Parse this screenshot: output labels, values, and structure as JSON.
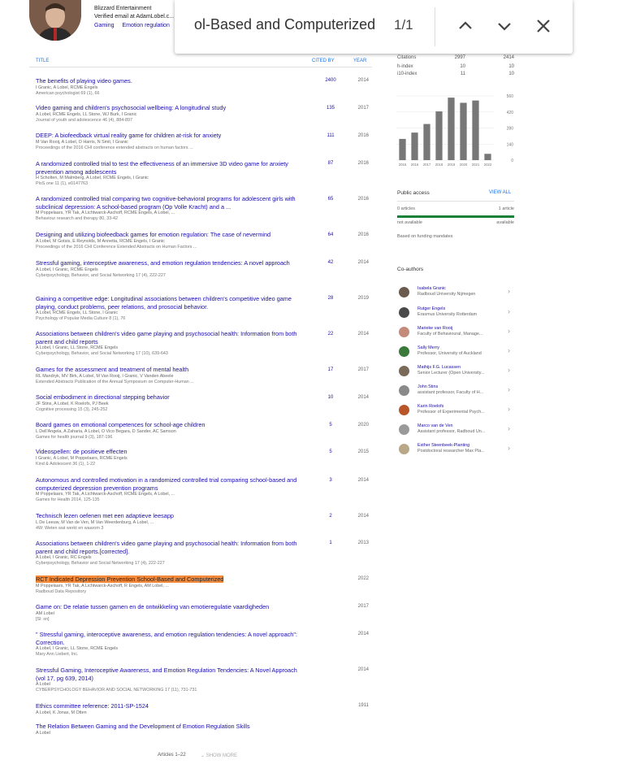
{
  "profile": {
    "affiliation": "Blizzard Entertainment",
    "email": "Verified email at AdamLobel.c...",
    "interests": [
      "Gaming",
      "Emotion regulation"
    ]
  },
  "find_bar": {
    "query": "ol-Based and Computerized",
    "count": "1/1",
    "icons": {
      "up": "chevron-up-icon",
      "down": "chevron-down-icon",
      "close": "close-icon"
    }
  },
  "table_header": {
    "title": "TITLE",
    "cited_by": "CITED BY",
    "year": "YEAR"
  },
  "publications": [
    {
      "title": "The benefits of playing video games.",
      "authors": "I Granic, A Lobel, RCME Engels",
      "venue": "American psychologist 69 (1), 66",
      "cited": "2400",
      "year": "2014"
    },
    {
      "title": "Video gaming and children's psychosocial wellbeing: A longitudinal study",
      "authors": "A Lobel, RCME Engels, LL Stone, WJ Burk, I Granic",
      "venue": "Journal of youth and adolescence 46 (4), 884-897",
      "cited": "135",
      "year": "2017"
    },
    {
      "title": "DEEP: A biofeedback virtual reality game for children at-risk for anxiety",
      "authors": "M Van Rooij, A Lobel, O Harris, N Smit, I Granic",
      "venue": "Proceedings of the 2016 CHI conference extended abstracts on human factors ...",
      "cited": "111",
      "year": "2016"
    },
    {
      "title": "A randomized controlled trial to test the effectiveness of an immersive 3D video game for anxiety prevention among adolescents",
      "authors": "H Scholten, M Malmberg, A Lobel, RCME Engels, I Granic",
      "venue": "PloS one 11 (1), e0147763",
      "cited": "87",
      "year": "2016"
    },
    {
      "title": "A randomized controlled trial comparing two cognitive-behavioral programs for adolescent girls with subclinical depression: A school-based program (Op Volle Kracht) and a ...",
      "authors": "M Poppelaars, YR Tak, A Lichtwarck-Aschoff, RCME Engels, A Lobel, ...",
      "venue": "Behaviour research and therapy 80, 33-42",
      "cited": "65",
      "year": "2016"
    },
    {
      "title": "Designing and utilizing biofeedback games for emotion regulation: The case of nevermind",
      "authors": "A Lobel, M Gotsis, E Reynolds, M Annetta, RCME Engels, I Granic",
      "venue": "Proceedings of the 2016 CHI Conference Extended Abstracts on Human Factors ...",
      "cited": "64",
      "year": "2016"
    },
    {
      "title": "Stressful gaming, interoceptive awareness, and emotion regulation tendencies: A novel approach",
      "authors": "A Lobel, I Granic, RCME Engels",
      "venue": "Cyberpsychology, Behavior, and Social Networking 17 (4), 222-227",
      "cited": "42",
      "year": "2014"
    },
    {
      "title": "Gaining a competitive edge: Longitudinal associations between children's competitive video game playing, conduct problems, peer relations, and prosocial behavior.",
      "authors": "A Lobel, RCME Engels, LL Stone, I Granic",
      "venue": "Psychology of Popular Media Culture 8 (1), 76",
      "cited": "28",
      "year": "2019"
    },
    {
      "title": "Associations between children's video game playing and psychosocial health: Information from both parent and child reports",
      "authors": "A Lobel, I Granic, LL Stone, RCME Engels",
      "venue": "Cyberpsychology, Behavior, and Social Networking 17 (10), 639-643",
      "cited": "22",
      "year": "2014"
    },
    {
      "title": "Games for the assessment and treatment of mental health",
      "authors": "RL Mandryk, MV Birk, A Lobel, M Van Rooij, I Granic, V Vanden Abeele",
      "venue": "Extended Abstracts Publication of the Annual Symposium on Computer-Human ...",
      "cited": "17",
      "year": "2017"
    },
    {
      "title": "Social embodiment in directional stepping behavior",
      "authors": "JF Stins, A Lobel, K Roelofs, PJ Beek",
      "venue": "Cognitive processing 15 (3), 245-252",
      "cited": "10",
      "year": "2014"
    },
    {
      "title": "Board games on emotional competences for school-age children",
      "authors": "L Dell'Angela, A Zaharia, A Lobel, O Vico Begara, D Sander, AC Samson",
      "venue": "Games for health journal 9 (3), 187-196",
      "cited": "5",
      "year": "2020"
    },
    {
      "title": "Videospellen: de positieve effecten",
      "authors": "I Granic, A Lobel, M Poppelaars, RCME Engels",
      "venue": "Kind & Adolescent 36 (1), 1-22",
      "cited": "5",
      "year": "2015"
    },
    {
      "title": "Autonomous and controlled motivation in a randomized controlled trial comparing school-based and computerized depression prevention programs",
      "authors": "M Poppelaars, YR Tak, A Lichtwarck-Aschoff, RCME Engels, A Lobel, ...",
      "venue": "Games for Health 2014, 125-135",
      "cited": "3",
      "year": "2014"
    },
    {
      "title": "Technisch lezen oefenen met een adaptieve leesapp",
      "authors": "L De Leeuw, M Van de Ven, M Van Weerdenburg, A Lobel, ...",
      "venue": "4W: Weten wat werkt en waarom 3",
      "cited": "2",
      "year": "2014"
    },
    {
      "title": "Associations between children's video game playing and psychosocial health: Information from both parent and child reports.[corrected].",
      "authors": "A Lobel, I Granic, RC Engels",
      "venue": "Cyberpsychology, Behavior and Social Networking 17 (4), 222-227",
      "cited": "1",
      "year": "2013"
    },
    {
      "title": "RCT Indicated Depression Prevention School-Based and Computerized",
      "authors": "M Poppelaars, YR Tak, A Lichtwarck-Aschoff, R Engels, AM Lobel, ...",
      "venue": "Radboud Data Repository",
      "cited": "",
      "year": "2022"
    },
    {
      "title": "Game on: De relatie tussen gamen en de ontwikkeling van emotieregulatie vaardigheden",
      "authors": "AM Lobel",
      "venue": "[Sl: sn]",
      "cited": "",
      "year": "2017"
    },
    {
      "title": "\" Stressful gaming, interoceptive awareness, and emotion regulation tendencies: A novel approach\": Correction.",
      "authors": "A Lobel, I Granic, LL Stone, RCME Engels",
      "venue": "Mary Ann Liebert, Inc.",
      "cited": "",
      "year": "2014"
    },
    {
      "title": "Stressful Gaming, Interoceptive Awareness, and Emotion Regulation Tendencies: A Novel Approach (vol 17, pg 639, 2014)",
      "authors": "A Lobel",
      "venue": "CYBERPSYCHOLOGY BEHAVIOR AND SOCIAL NETWORKING 17 (11), 731-731",
      "cited": "",
      "year": "2014"
    },
    {
      "title": "Ethics committee reference: 2011-SP-1524",
      "authors": "A Lobel, K Jonas, M Otten",
      "venue": "",
      "cited": "",
      "year": "1911"
    },
    {
      "title": "The Relation Between Gaming and the Development of Emotion Regulation Skills",
      "authors": "A Lobel",
      "venue": "",
      "cited": "",
      "year": ""
    }
  ],
  "stats": {
    "rows": [
      {
        "label": "Citations",
        "all": "2997",
        "since": "2414"
      },
      {
        "label": "h-index",
        "all": "10",
        "since": "10"
      },
      {
        "label": "i10-index",
        "all": "11",
        "since": "10"
      }
    ]
  },
  "chart_data": {
    "type": "bar",
    "categories": [
      "2015",
      "2016",
      "2017",
      "2018",
      "2019",
      "2020",
      "2021",
      "2022"
    ],
    "values": [
      185,
      240,
      315,
      425,
      545,
      500,
      520,
      55
    ],
    "yticks": [
      "560",
      "420",
      "280",
      "140",
      "0"
    ],
    "ylim": [
      0,
      560
    ],
    "color": "#777777",
    "grid": true
  },
  "public_access": {
    "title": "Public access",
    "view_all": "VIEW ALL",
    "left_count": "0 articles",
    "right_count": "1 article",
    "not_available": "not available",
    "available": "available",
    "note": "Based on funding mandates",
    "bar_color": "#188038"
  },
  "coauthors": {
    "title": "Co-authors",
    "items": [
      {
        "name": "Isabela Granic",
        "desc": "Radboud University Nijmegen",
        "color": "#6b5a4e"
      },
      {
        "name": "Rutger Engels",
        "desc": "Erasmus University Rotterdam",
        "color": "#4a4a4a"
      },
      {
        "name": "Marieke van Rooij",
        "desc": "Faculty of Behavioural, Manage...",
        "color": "#c48a7a"
      },
      {
        "name": "Sally Merry",
        "desc": "Professor, University of Auckland",
        "color": "#3a7a3a"
      },
      {
        "name": "Mathijs F.G. Lucassen",
        "desc": "Senior Lecturer (Open University...",
        "color": "#7a6a5a"
      },
      {
        "name": "John Stins",
        "desc": "assistant professor, Faculty of H...",
        "color": "#8a8a8a"
      },
      {
        "name": "Karin Roelofs",
        "desc": "Professor of Experimental Psych...",
        "color": "#b8562a"
      },
      {
        "name": "Marco van de Ven",
        "desc": "Assistant professor, Radboud Un...",
        "color": "#9a9a9a"
      },
      {
        "name": "Esther Steenbeek-Planting",
        "desc": "Postdoctoral researcher Max Pla...",
        "color": "#b8a888"
      }
    ]
  },
  "footer": {
    "articles": "Articles 1–22",
    "show_more": "SHOW MORE"
  }
}
